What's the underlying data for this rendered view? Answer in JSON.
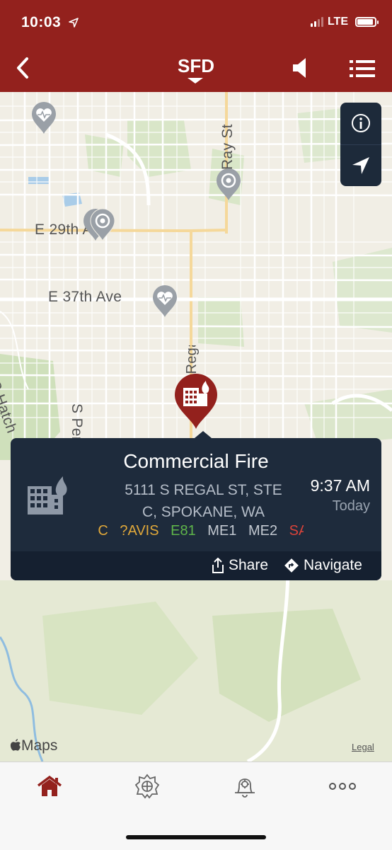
{
  "status_bar": {
    "time": "10:03",
    "network": "LTE",
    "signal_bars_filled": 2,
    "signal_bars_total": 4,
    "battery_level": 0.9
  },
  "nav": {
    "title": "SFD"
  },
  "map": {
    "street_labels": [
      "E 29th Ave",
      "E 37th Ave",
      "S Perry St",
      "Ray St",
      "S Hatch",
      "S Regal St"
    ],
    "maps_brand": "Maps",
    "legal_link": "Legal"
  },
  "callout": {
    "title": "Commercial Fire",
    "address_line1": "5111 S REGAL ST, STE",
    "address_line2": "C, SPOKANE, WA",
    "time": "9:37 AM",
    "day": "Today",
    "units": [
      {
        "label": "BC",
        "color": "#e0a83a"
      },
      {
        "label": "?AVIS",
        "color": "#e0a83a"
      },
      {
        "label": "E81",
        "color": "#5fb54a"
      },
      {
        "label": "ME1",
        "color": "#c3c9d1"
      },
      {
        "label": "ME2",
        "color": "#c3c9d1"
      },
      {
        "label": "SA",
        "color": "#d9433a"
      }
    ],
    "share_label": "Share",
    "navigate_label": "Navigate"
  },
  "tabs": [
    {
      "name": "home",
      "icon": "home-icon",
      "active": true
    },
    {
      "name": "incidents",
      "icon": "fire-badge-icon",
      "active": false
    },
    {
      "name": "alerts",
      "icon": "alert-bell-icon",
      "active": false
    },
    {
      "name": "more",
      "icon": "more-icon",
      "active": false
    }
  ],
  "colors": {
    "brand": "#93211d",
    "callout_bg": "#1e2b3c",
    "pin_gray": "#9aa0a7"
  }
}
